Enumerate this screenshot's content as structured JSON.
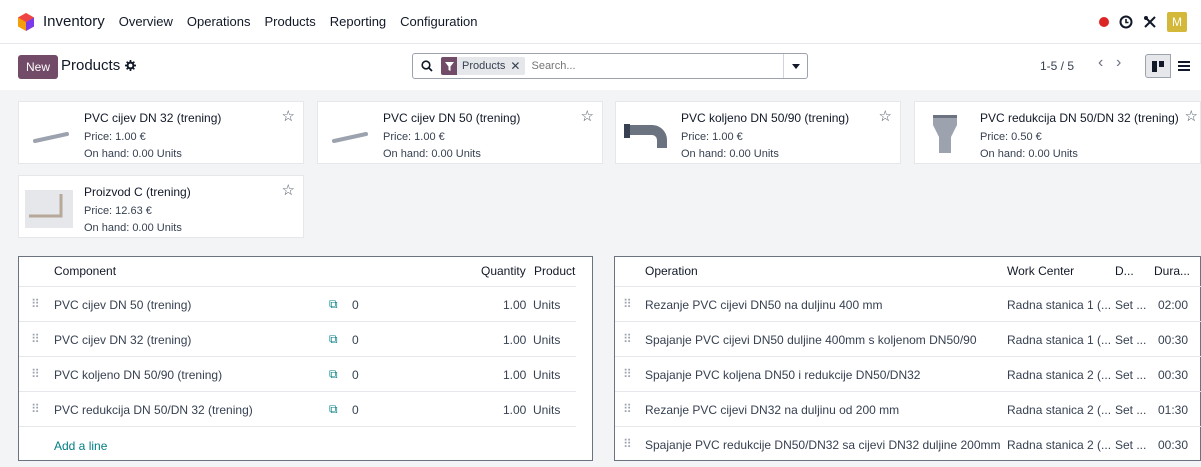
{
  "topbar": {
    "app_name": "Inventory",
    "menu": [
      "Overview",
      "Operations",
      "Products",
      "Reporting",
      "Configuration"
    ],
    "avatar_letter": "M"
  },
  "control_panel": {
    "new_label": "New",
    "breadcrumb": "Products",
    "facet_label": "Products",
    "search_placeholder": "Search...",
    "pager": "1-5 / 5"
  },
  "products": [
    {
      "name": "PVC cijev DN 32 (trening)",
      "price": "Price: 1.00 €",
      "on_hand": "On hand: 0.00 Units"
    },
    {
      "name": "PVC cijev DN 50 (trening)",
      "price": "Price: 1.00 €",
      "on_hand": "On hand: 0.00 Units"
    },
    {
      "name": "PVC koljeno DN 50/90 (trening)",
      "price": "Price: 1.00 €",
      "on_hand": "On hand: 0.00 Units"
    },
    {
      "name": "PVC redukcija DN 50/DN 32 (trening)",
      "price": "Price: 0.50 €",
      "on_hand": "On hand: 0.00 Units"
    },
    {
      "name": "Proizvod C (trening)",
      "price": "Price: 12.63 €",
      "on_hand": "On hand: 0.00 Units"
    }
  ],
  "components": {
    "headers": {
      "component": "Component",
      "quantity": "Quantity",
      "product": "Product"
    },
    "rows": [
      {
        "name": "PVC cijev DN 50 (trening)",
        "forecast": "0",
        "qty": "1.00",
        "uom": "Units"
      },
      {
        "name": "PVC cijev DN 32 (trening)",
        "forecast": "0",
        "qty": "1.00",
        "uom": "Units"
      },
      {
        "name": "PVC koljeno DN 50/90 (trening)",
        "forecast": "0",
        "qty": "1.00",
        "uom": "Units"
      },
      {
        "name": "PVC redukcija DN 50/DN 32 (trening)",
        "forecast": "0",
        "qty": "1.00",
        "uom": "Units"
      }
    ],
    "add_line": "Add a line"
  },
  "operations": {
    "headers": {
      "operation": "Operation",
      "work_center": "Work Center",
      "d": "D...",
      "duration": "Dura..."
    },
    "rows": [
      {
        "name": "Rezanje PVC cijevi DN50 na duljinu 400 mm",
        "wc": "Radna stanica 1 (...",
        "d": "Set ...",
        "dur": "02:00"
      },
      {
        "name": "Spajanje PVC cijevi DN50 duljine 400mm s koljenom DN50/90",
        "wc": "Radna stanica 1 (...",
        "d": "Set ...",
        "dur": "00:30"
      },
      {
        "name": "Spajanje PVC koljena DN50 i redukcije DN50/DN32",
        "wc": "Radna stanica 2 (...",
        "d": "Set ...",
        "dur": "00:30"
      },
      {
        "name": "Rezanje PVC cijevi DN32 na duljinu od 200 mm",
        "wc": "Radna stanica 2 (...",
        "d": "Set ...",
        "dur": "01:30"
      },
      {
        "name": "Spajanje PVC redukcije DN50/DN32 sa cijevi DN32 duljine 200mm",
        "wc": "Radna stanica 2 (...",
        "d": "Set ...",
        "dur": "00:30"
      }
    ]
  },
  "colors": {
    "brand": "#714b67",
    "link": "#017e84",
    "record": "#dc2626"
  }
}
